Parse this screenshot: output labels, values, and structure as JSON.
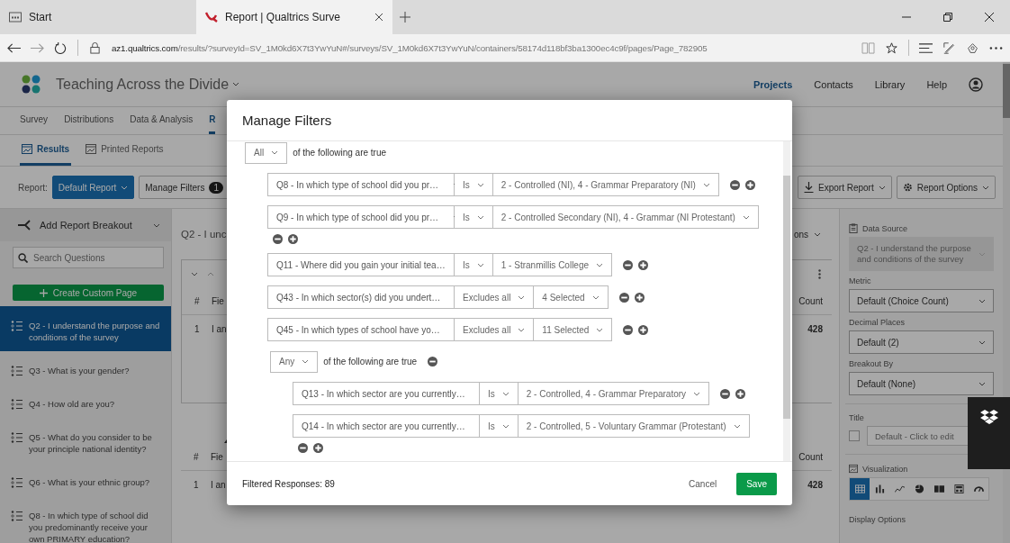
{
  "browser": {
    "tabs": [
      {
        "title": "Start",
        "kind": "start",
        "selected": false
      },
      {
        "title": "Report | Qualtrics Surve",
        "kind": "site",
        "selected": true
      }
    ],
    "url_host": "az1.qualtrics.com",
    "url_path": "/results/?surveyId=SV_1M0kd6X7t3YwYuN#/surveys/SV_1M0kd6X7t3YwYuN/containers/58174d118bf3ba1300ec4c9f/pages/Page_782905"
  },
  "app": {
    "title": "Teaching Across the Divide",
    "nav": [
      {
        "label": "Projects",
        "selected": true
      },
      {
        "label": "Contacts",
        "selected": false
      },
      {
        "label": "Library",
        "selected": false
      },
      {
        "label": "Help",
        "selected": false
      }
    ],
    "tabs": [
      {
        "label": "Survey",
        "selected": false
      },
      {
        "label": "Distributions",
        "selected": false
      },
      {
        "label": "Data & Analysis",
        "selected": false
      },
      {
        "label": "R",
        "selected": true
      }
    ],
    "subtabs": [
      {
        "label": "Results",
        "selected": true
      },
      {
        "label": "Printed Reports",
        "selected": false
      }
    ],
    "toolbar": {
      "report_label": "Report:",
      "report": "Default Report",
      "manage_filters": "Manage Filters",
      "filter_count": "1",
      "export": "Export Report",
      "options": "Report Options"
    }
  },
  "sidebar": {
    "breakout": "Add Report Breakout",
    "search_placeholder": "Search Questions",
    "create": "Create Custom Page",
    "questions": [
      {
        "label": "Q2 - I understand the purpose and conditions of the survey",
        "selected": true
      },
      {
        "label": "Q3 - What is your gender?",
        "selected": false
      },
      {
        "label": "Q4 - How old are you?",
        "selected": false
      },
      {
        "label": "Q5 - What do you consider to be your principle national identity?",
        "selected": false
      },
      {
        "label": "Q6 - What is your ethnic group?",
        "selected": false
      },
      {
        "label": "Q8 - In which type of school did you predominantly receive your own PRIMARY education?",
        "selected": false
      }
    ]
  },
  "content": {
    "title": "Q2 - I unc",
    "options": "ons",
    "tables": [
      {
        "hash": "#",
        "field": "Fie",
        "count_header": "Count",
        "row_num": "1",
        "row_field": "I an",
        "count": "428"
      },
      {
        "hash": "#",
        "field": "Fie",
        "count_header": "Count",
        "row_num": "1",
        "row_field": "I an",
        "count": "428"
      }
    ]
  },
  "panel": {
    "data_source_label": "Data Source",
    "data_source": "Q2 - I understand the purpose and conditions of the survey",
    "metric_label": "Metric",
    "metric": "Default (Choice Count)",
    "decimal_label": "Decimal Places",
    "decimal": "Default (2)",
    "breakout_label": "Breakout By",
    "breakout": "Default (None)",
    "title_label": "Title",
    "title_checked": false,
    "title_placeholder": "Default - Click to edit",
    "viz_label": "Visualization",
    "viz": [
      {
        "kind": "table",
        "selected": true
      },
      {
        "kind": "bar",
        "selected": false
      },
      {
        "kind": "line",
        "selected": false
      },
      {
        "kind": "pie",
        "selected": false
      },
      {
        "kind": "block",
        "selected": false
      },
      {
        "kind": "grid",
        "selected": false
      },
      {
        "kind": "gauge",
        "selected": false
      }
    ],
    "display_label": "Display Options"
  },
  "modal": {
    "title": "Manage Filters",
    "group": {
      "quantifier": "All",
      "text": "of the following are true",
      "conditions": [
        {
          "question": "Q8 - In which type of school did you pr…",
          "operator": "Is",
          "value": "2 - Controlled (NI), 4 - Grammar Preparatory (NI)"
        },
        {
          "question": "Q9 - In which type of school did you pr…",
          "operator": "Is",
          "value": "2 - Controlled Secondary (NI), 4 - Grammar (NI Protestant)"
        },
        {
          "question": "Q11 - Where did you gain your initial tea…",
          "operator": "Is",
          "value": "1 - Stranmillis College"
        },
        {
          "question": "Q43 - In which sector(s) did you undert…",
          "operator": "Excludes all",
          "value": "4 Selected"
        },
        {
          "question": "Q45 - In which types of school have yo…",
          "operator": "Excludes all",
          "value": "11 Selected"
        }
      ],
      "subgroup": {
        "quantifier": "Any",
        "text": "of the following are true",
        "conditions": [
          {
            "question": "Q13 - In which sector are you currently…",
            "operator": "Is",
            "value": "2 - Controlled, 4 - Grammar Preparatory"
          },
          {
            "question": "Q14 - In which sector are you currently…",
            "operator": "Is",
            "value": "2 - Controlled, 5 - Voluntary Grammar (Protestant)"
          }
        ]
      }
    },
    "filtered": "Filtered Responses: 89",
    "cancel": "Cancel",
    "save": "Save"
  }
}
